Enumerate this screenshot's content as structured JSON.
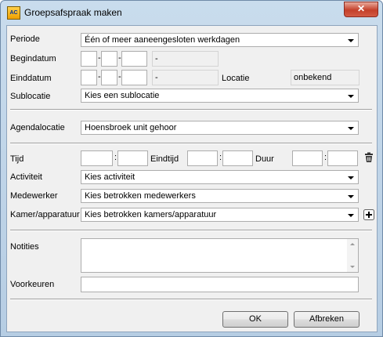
{
  "window": {
    "title": "Groepsafspraak maken",
    "app_icon": "AC",
    "close_glyph": "✕"
  },
  "form": {
    "periode": {
      "label": "Periode",
      "value": "Één of meer aaneengesloten werkdagen"
    },
    "begindatum": {
      "label": "Begindatum",
      "separator": "-",
      "weekday": "-"
    },
    "einddatum": {
      "label": "Einddatum",
      "separator": "-",
      "weekday": "-"
    },
    "locatie": {
      "label": "Locatie",
      "value": "onbekend"
    },
    "sublocatie": {
      "label": "Sublocatie",
      "value": "Kies een sublocatie"
    },
    "agendalocatie": {
      "label": "Agendalocatie",
      "value": "Hoensbroek unit gehoor"
    },
    "tijd": {
      "label": "Tijd",
      "separator": ":"
    },
    "eindtijd": {
      "label": "Eindtijd",
      "separator": ":"
    },
    "duur": {
      "label": "Duur",
      "separator": ":"
    },
    "activiteit": {
      "label": "Activiteit",
      "value": "Kies activiteit"
    },
    "medewerker": {
      "label": "Medewerker",
      "value": "Kies betrokken medewerkers"
    },
    "kamer": {
      "label": "Kamer/apparatuur",
      "value": "Kies betrokken kamers/apparatuur"
    },
    "notities": {
      "label": "Notities",
      "value": ""
    },
    "voorkeuren": {
      "label": "Voorkeuren",
      "value": ""
    }
  },
  "icons": {
    "delete": "trash-icon",
    "add": "plus-icon"
  },
  "buttons": {
    "ok": "OK",
    "cancel": "Afbreken"
  }
}
